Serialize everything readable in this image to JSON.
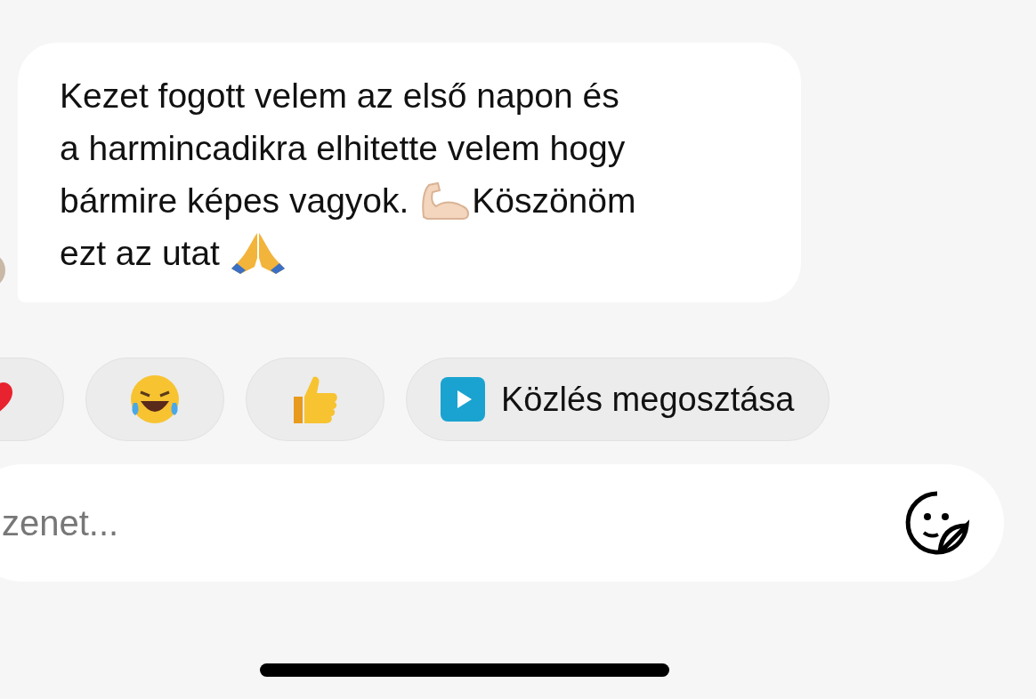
{
  "message": {
    "lines": [
      [
        {
          "kind": "text",
          "text": "Kezet fogott velem az első napon és"
        }
      ],
      [
        {
          "kind": "text",
          "text": "a harmincadikra elhitette velem hogy"
        }
      ],
      [
        {
          "kind": "text",
          "text": "bármire képes vagyok. "
        },
        {
          "kind": "flexed-arm"
        },
        {
          "kind": "text",
          "text": "Köszönöm"
        }
      ],
      [
        {
          "kind": "text",
          "text": "ezt az utat "
        },
        {
          "kind": "praying-hands"
        }
      ]
    ]
  },
  "quick_replies": [
    {
      "kind": "heart"
    },
    {
      "kind": "laughing"
    },
    {
      "kind": "thumbs-up"
    },
    {
      "kind": "share",
      "label": "Közlés megosztása"
    }
  ],
  "composer": {
    "placeholder": "zenet..."
  }
}
